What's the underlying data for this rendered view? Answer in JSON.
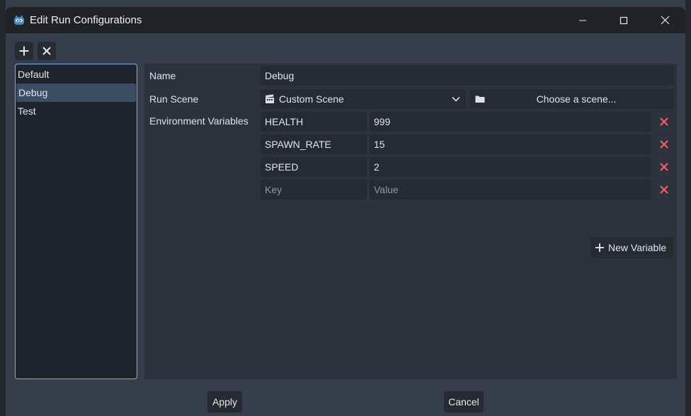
{
  "window": {
    "title": "Edit Run Configurations",
    "app_icon": "godot-icon"
  },
  "toolbar": {
    "add_icon": "plus-icon",
    "remove_icon": "close-icon"
  },
  "configs": [
    {
      "label": "Default",
      "selected": false
    },
    {
      "label": "Debug",
      "selected": true
    },
    {
      "label": "Test",
      "selected": false
    }
  ],
  "form": {
    "name_label": "Name",
    "name_value": "Debug",
    "run_scene_label": "Run Scene",
    "run_scene_option": "Custom Scene",
    "choose_scene": "Choose a scene...",
    "env_label": "Environment Variables",
    "env_vars": [
      {
        "key": "HEALTH",
        "value": "999"
      },
      {
        "key": "SPAWN_RATE",
        "value": "15"
      },
      {
        "key": "SPEED",
        "value": "2"
      }
    ],
    "key_placeholder": "Key",
    "value_placeholder": "Value",
    "new_variable": "New Variable"
  },
  "footer": {
    "apply": "Apply",
    "cancel": "Cancel"
  },
  "colors": {
    "accent": "#74aee6",
    "delete": "#ff5f5f",
    "panel": "#2d333d",
    "field": "#262b33"
  }
}
